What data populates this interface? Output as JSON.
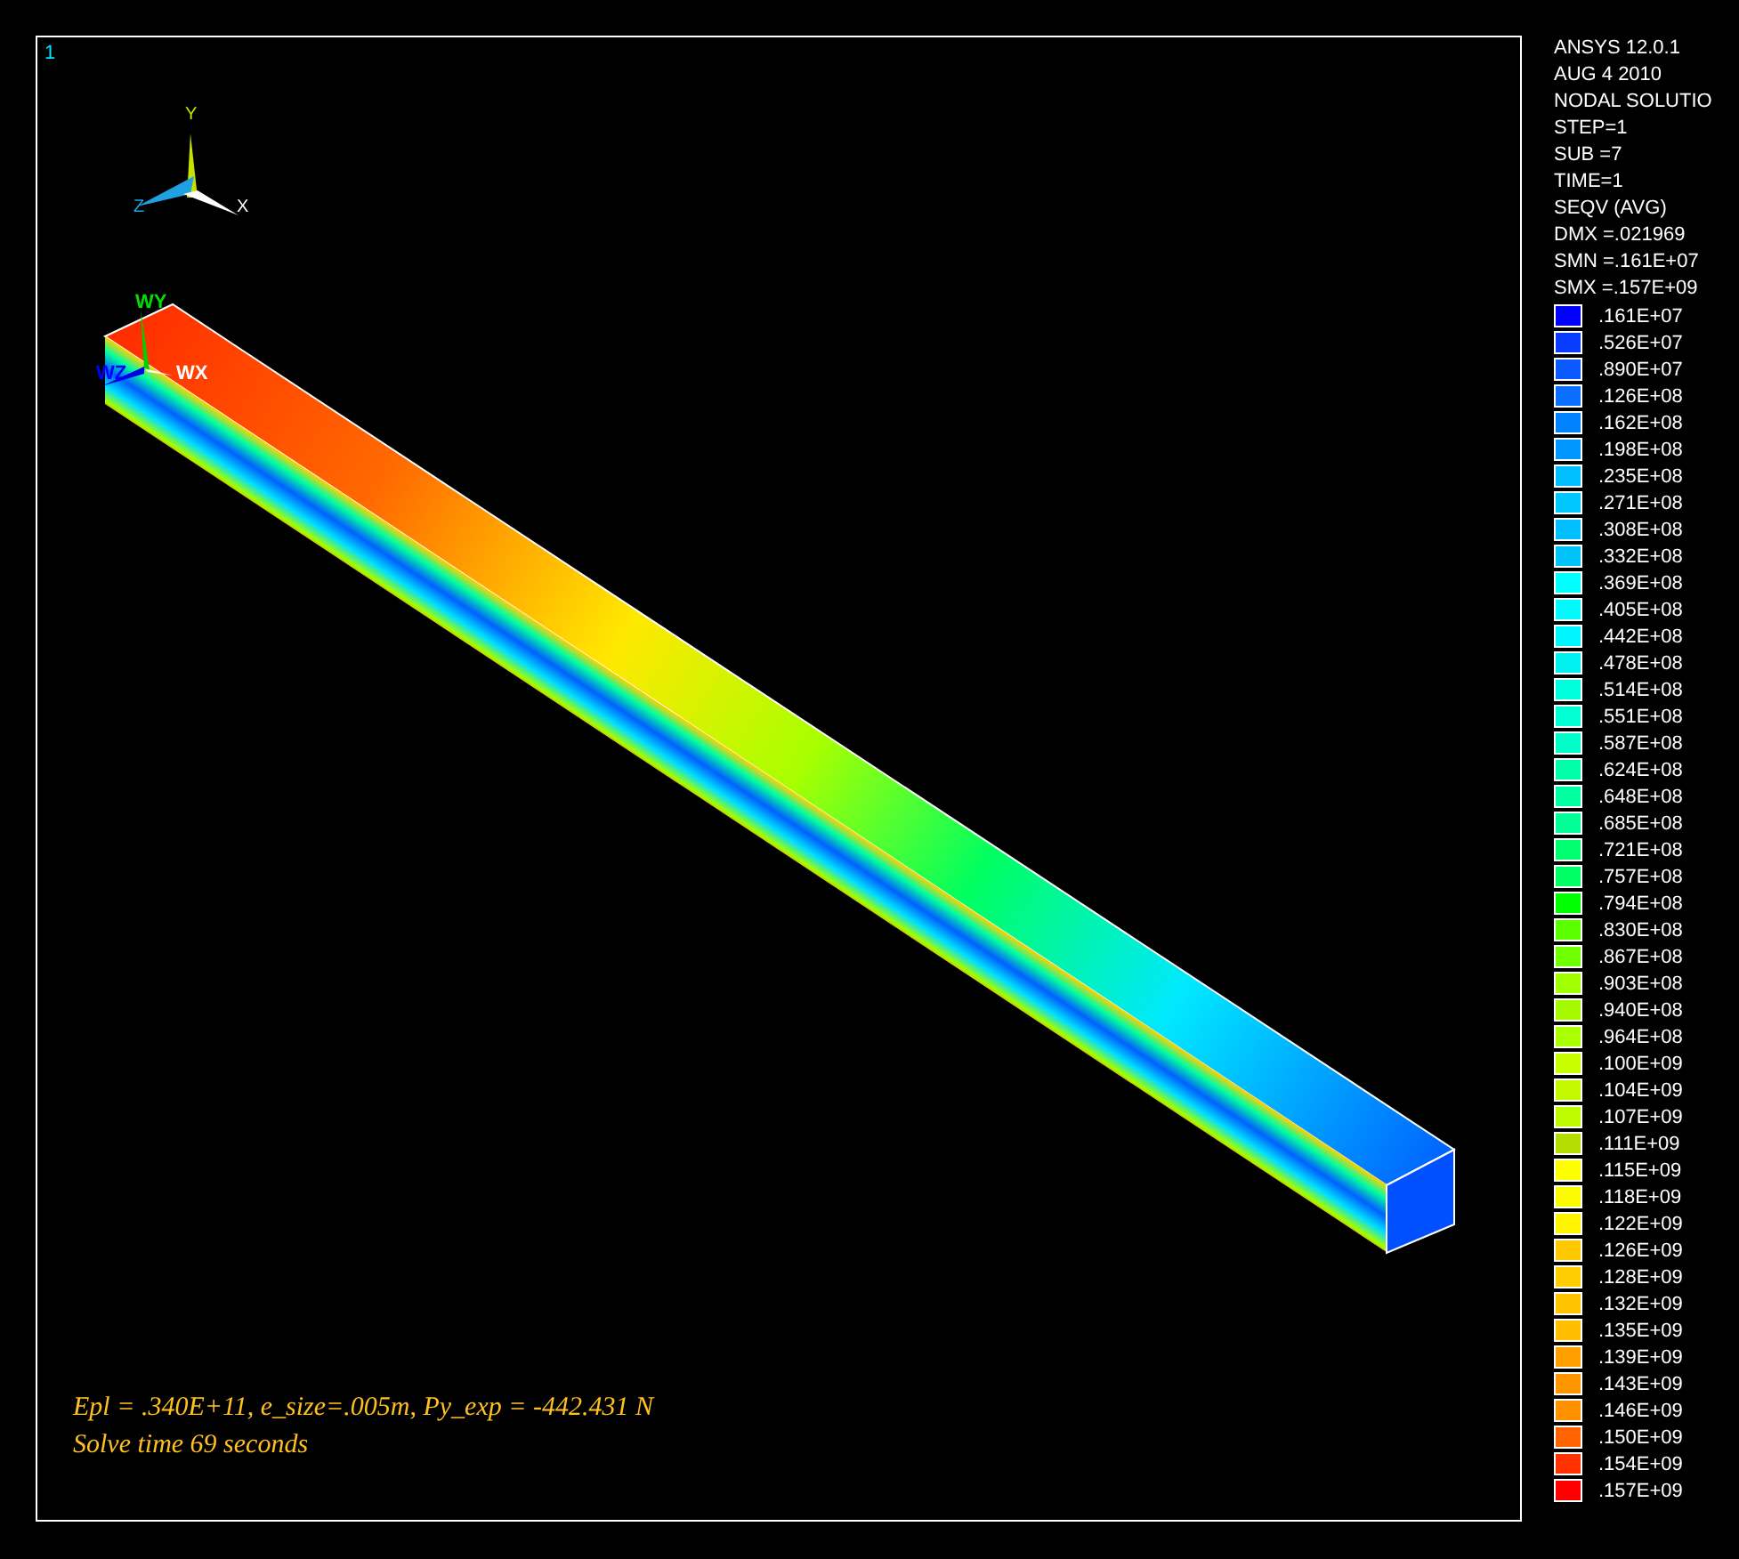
{
  "viewport": {
    "window_number": "1",
    "triad": {
      "x_label": "X",
      "y_label": "Y",
      "z_label": "Z"
    },
    "work_plane": {
      "wx_label": "WX",
      "wy_label": "WY",
      "wz_label": "WZ"
    },
    "notes": [
      "Epl = .340E+11,  e_size=.005m, Py_exp = -442.431 N",
      "Solve time  69 seconds"
    ]
  },
  "legend": {
    "header": [
      "ANSYS 12.0.1",
      "AUG  4 2010",
      "NODAL SOLUTIO",
      "STEP=1",
      "SUB =7",
      "TIME=1",
      "SEQV    (AVG)",
      "DMX =.021969",
      "SMN =.161E+07",
      "SMX =.157E+09"
    ],
    "entries": [
      {
        "label": ".161E+07",
        "color": "#0000ff"
      },
      {
        "label": ".526E+07",
        "color": "#0a3cff"
      },
      {
        "label": ".890E+07",
        "color": "#0a5aff"
      },
      {
        "label": ".126E+08",
        "color": "#0a6eff"
      },
      {
        "label": ".162E+08",
        "color": "#0082ff"
      },
      {
        "label": ".198E+08",
        "color": "#0096ff"
      },
      {
        "label": ".235E+08",
        "color": "#00beff"
      },
      {
        "label": ".271E+08",
        "color": "#00c8ff"
      },
      {
        "label": ".308E+08",
        "color": "#00beff"
      },
      {
        "label": ".332E+08",
        "color": "#00c3fa"
      },
      {
        "label": ".369E+08",
        "color": "#00ffff"
      },
      {
        "label": ".405E+08",
        "color": "#00fafe"
      },
      {
        "label": ".442E+08",
        "color": "#00f5fd"
      },
      {
        "label": ".478E+08",
        "color": "#00f0f0"
      },
      {
        "label": ".514E+08",
        "color": "#00ffdc"
      },
      {
        "label": ".551E+08",
        "color": "#00ffd2"
      },
      {
        "label": ".587E+08",
        "color": "#00ffc8"
      },
      {
        "label": ".624E+08",
        "color": "#00ffaa"
      },
      {
        "label": ".648E+08",
        "color": "#00ffa0"
      },
      {
        "label": ".685E+08",
        "color": "#00ff96"
      },
      {
        "label": ".721E+08",
        "color": "#00ff6e"
      },
      {
        "label": ".757E+08",
        "color": "#00ff64"
      },
      {
        "label": ".794E+08",
        "color": "#00ff00"
      },
      {
        "label": ".830E+08",
        "color": "#5aff00"
      },
      {
        "label": ".867E+08",
        "color": "#6eff00"
      },
      {
        "label": ".903E+08",
        "color": "#a0ff00"
      },
      {
        "label": ".940E+08",
        "color": "#a5fa00"
      },
      {
        "label": ".964E+08",
        "color": "#aaff00"
      },
      {
        "label": ".100E+09",
        "color": "#c8ff00"
      },
      {
        "label": ".104E+09",
        "color": "#c3fa00"
      },
      {
        "label": ".107E+09",
        "color": "#befa00"
      },
      {
        "label": ".111E+09",
        "color": "#b4dc00"
      },
      {
        "label": ".115E+09",
        "color": "#ffff00"
      },
      {
        "label": ".118E+09",
        "color": "#fafa00"
      },
      {
        "label": ".122E+09",
        "color": "#fff500"
      },
      {
        "label": ".126E+09",
        "color": "#ffc800"
      },
      {
        "label": ".128E+09",
        "color": "#ffcd00"
      },
      {
        "label": ".132E+09",
        "color": "#ffc300"
      },
      {
        "label": ".135E+09",
        "color": "#ffbe00"
      },
      {
        "label": ".139E+09",
        "color": "#ffa000"
      },
      {
        "label": ".143E+09",
        "color": "#ff9600"
      },
      {
        "label": ".146E+09",
        "color": "#ff9100"
      },
      {
        "label": ".150E+09",
        "color": "#ff6400"
      },
      {
        "label": ".154E+09",
        "color": "#ff3200"
      },
      {
        "label": ".157E+09",
        "color": "#ff0000"
      }
    ]
  }
}
